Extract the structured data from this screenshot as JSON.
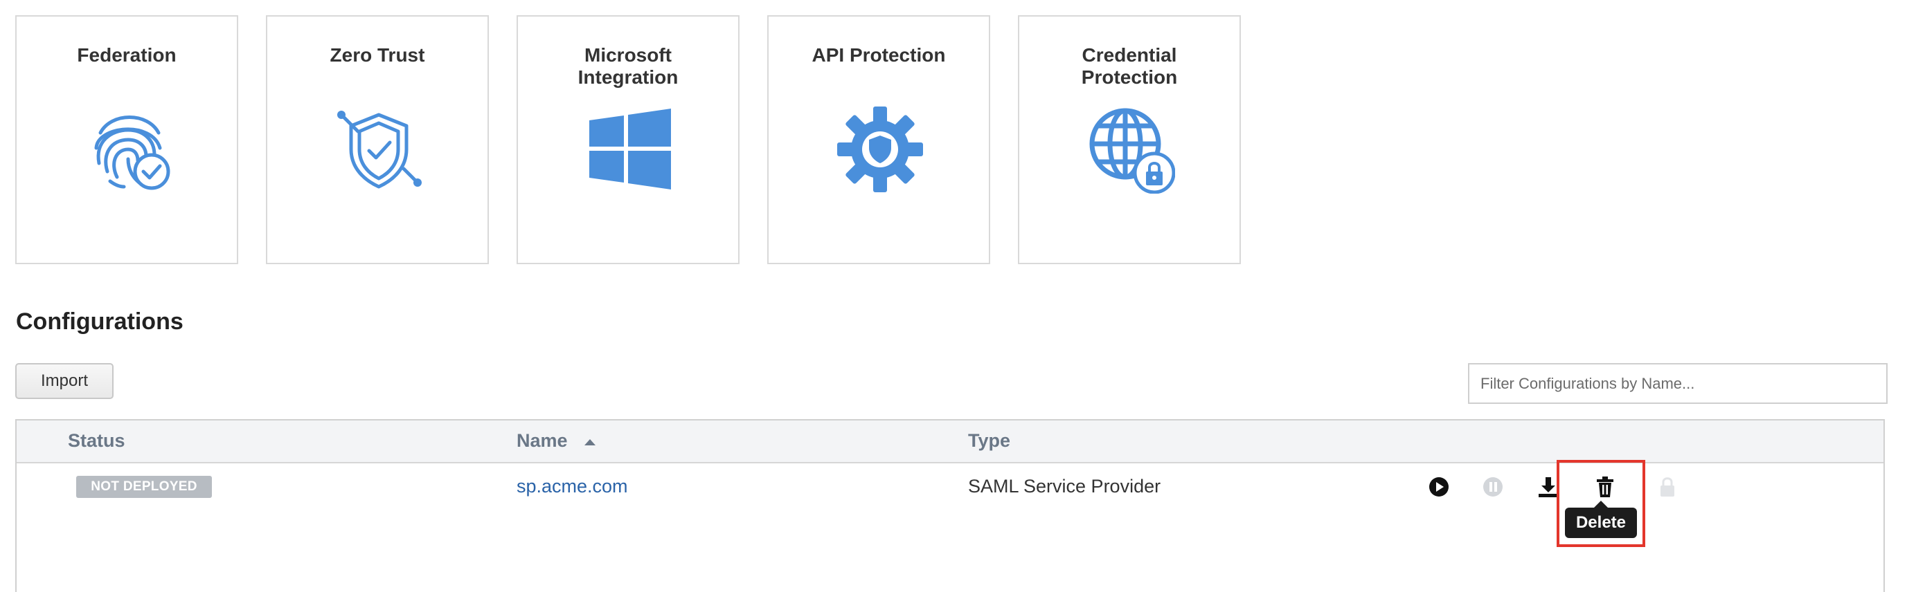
{
  "tiles": [
    {
      "title": "Federation",
      "icon": "fingerprint-check-icon"
    },
    {
      "title": "Zero Trust",
      "icon": "shield-check-network-icon"
    },
    {
      "title": "Microsoft\nIntegration",
      "icon": "windows-logo-icon"
    },
    {
      "title": "API Protection",
      "icon": "gear-shield-icon"
    },
    {
      "title": "Credential\nProtection",
      "icon": "globe-lock-icon"
    }
  ],
  "configurations": {
    "title": "Configurations",
    "import_label": "Import",
    "filter_placeholder": "Filter Configurations by Name...",
    "columns": {
      "status": "Status",
      "name": "Name",
      "type": "Type"
    },
    "sort": {
      "column": "Name",
      "direction": "ascending",
      "icon": "sort-up-icon"
    },
    "rows": [
      {
        "status": "NOT DEPLOYED",
        "name": "sp.acme.com",
        "type": "SAML Service Provider"
      }
    ],
    "actions": [
      "play-icon",
      "pause-icon",
      "download-icon",
      "trash-icon",
      "lock-icon"
    ],
    "tooltip": "Delete"
  },
  "colors": {
    "accent": "#4a8fdb",
    "link": "#2a63a8",
    "highlight": "#e3362c",
    "badge": "#b7bcc2"
  }
}
